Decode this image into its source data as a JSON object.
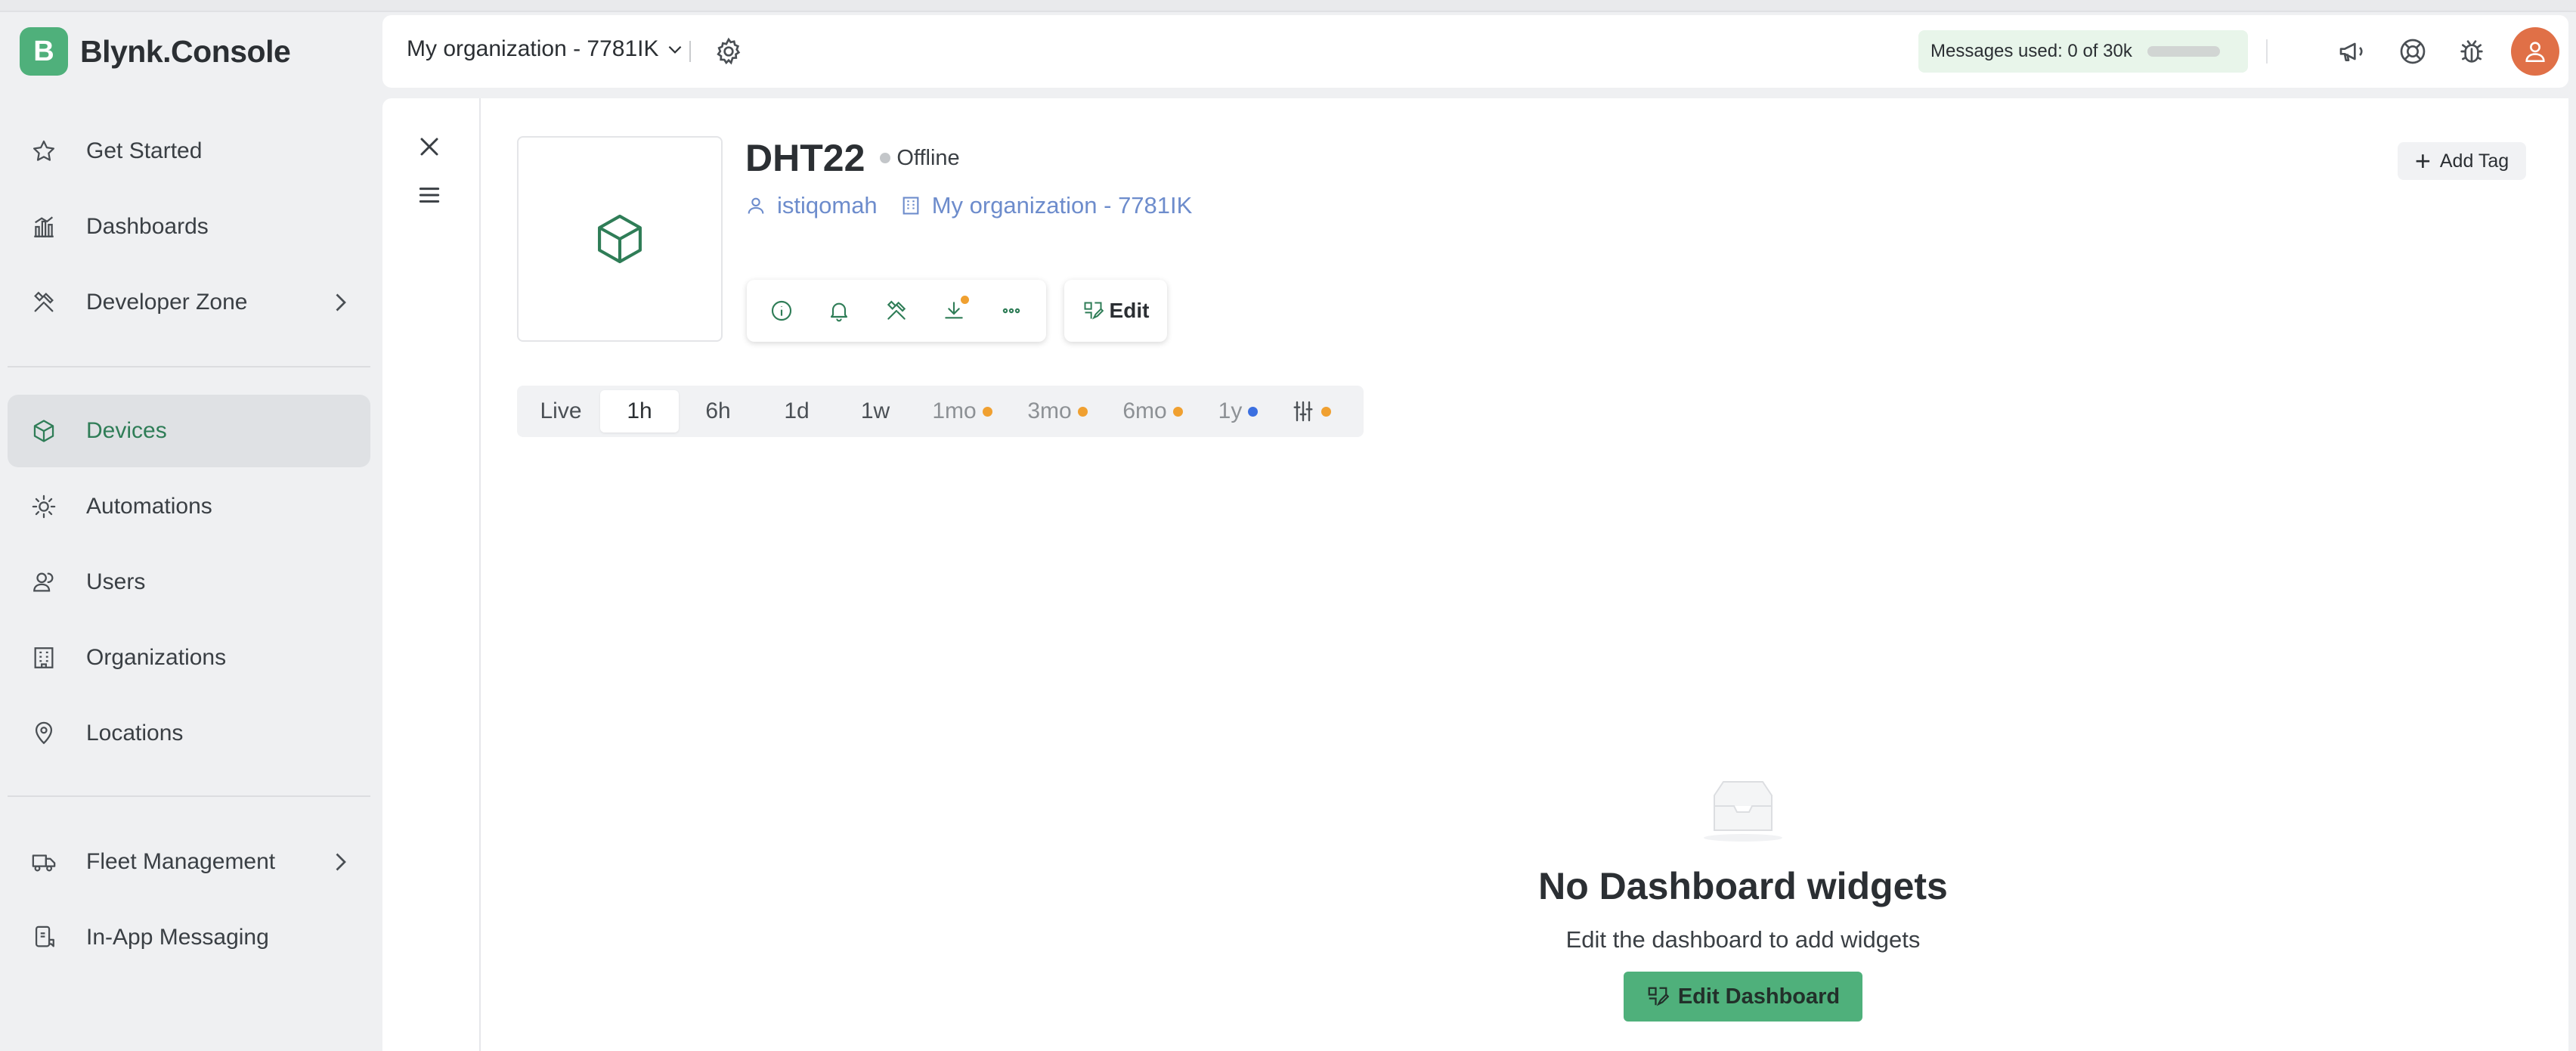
{
  "brand": {
    "logo_letter": "B",
    "name": "Blynk.Console",
    "color": "#4fb07b"
  },
  "sidebar": {
    "items": [
      {
        "label": "Get Started",
        "icon": "star-icon"
      },
      {
        "label": "Dashboards",
        "icon": "bar-chart-icon"
      },
      {
        "label": "Developer Zone",
        "icon": "tools-icon",
        "expandable": true
      },
      {
        "label": "Devices",
        "icon": "cube-icon",
        "active": true
      },
      {
        "label": "Automations",
        "icon": "automation-icon"
      },
      {
        "label": "Users",
        "icon": "users-icon"
      },
      {
        "label": "Organizations",
        "icon": "building-icon"
      },
      {
        "label": "Locations",
        "icon": "pin-icon"
      },
      {
        "label": "Fleet Management",
        "icon": "truck-icon",
        "expandable": true
      },
      {
        "label": "In-App Messaging",
        "icon": "message-icon"
      }
    ]
  },
  "header": {
    "org_label": "My organization - 7781IK",
    "messages_label": "Messages used: 0 of 30k",
    "messages_used_fraction": 0
  },
  "device": {
    "name": "DHT22",
    "status": "Offline",
    "owner": "istiqomah",
    "organization": "My organization - 7781IK",
    "edit_label": "Edit",
    "add_tag_label": "Add Tag"
  },
  "time_ranges": [
    {
      "label": "Live",
      "enabled": true
    },
    {
      "label": "1h",
      "enabled": true,
      "selected": true
    },
    {
      "label": "6h",
      "enabled": true
    },
    {
      "label": "1d",
      "enabled": true
    },
    {
      "label": "1w",
      "enabled": true
    },
    {
      "label": "1mo",
      "enabled": false,
      "dot": "#f0a030"
    },
    {
      "label": "3mo",
      "enabled": false,
      "dot": "#f0a030"
    },
    {
      "label": "6mo",
      "enabled": false,
      "dot": "#f0a030"
    },
    {
      "label": "1y",
      "enabled": false,
      "dot": "#3b6fe0"
    }
  ],
  "empty_state": {
    "title": "No Dashboard widgets",
    "subtitle": "Edit the dashboard to add widgets",
    "button_label": "Edit Dashboard"
  },
  "colors": {
    "accent": "#4fb07b",
    "link": "#6d8ccc",
    "warning_dot": "#f0a030",
    "info_dot": "#3b6fe0",
    "avatar": "#e07047"
  }
}
